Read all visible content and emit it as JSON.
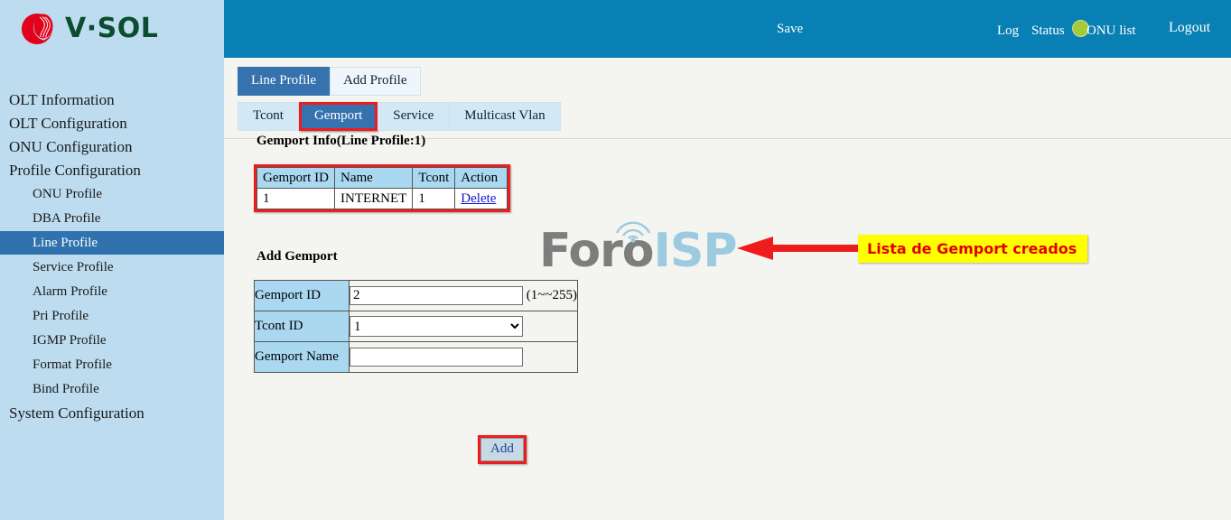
{
  "brand": {
    "name": "V·SOL",
    "logo_icon": "vsol-logo-icon",
    "logo_red": "#e2001a",
    "logo_green": "#0b4d2e"
  },
  "header": {
    "background": "#0880b4",
    "save_label": "Save",
    "status_dot_icon": "status-indicator-icon",
    "status_dot_color": "#a7ca3a",
    "links": [
      {
        "label": "Log"
      },
      {
        "label": "Status"
      },
      {
        "label": "ONU list"
      },
      {
        "label": "Logout"
      }
    ],
    "log_label": "Log",
    "status_label": "Status",
    "onu_list_label": "ONU list",
    "logout_label": "Logout"
  },
  "sidebar": {
    "background": "#bddcef",
    "active_background": "#2f72ad",
    "items": [
      {
        "label": "OLT Information",
        "level": 0,
        "active": false
      },
      {
        "label": "OLT Configuration",
        "level": 0,
        "active": false
      },
      {
        "label": "ONU Configuration",
        "level": 0,
        "active": false
      },
      {
        "label": "Profile Configuration",
        "level": 0,
        "active": false
      },
      {
        "label": "ONU Profile",
        "level": 1,
        "active": false
      },
      {
        "label": "DBA Profile",
        "level": 1,
        "active": false
      },
      {
        "label": "Line Profile",
        "level": 1,
        "active": true
      },
      {
        "label": "Service Profile",
        "level": 1,
        "active": false
      },
      {
        "label": "Alarm Profile",
        "level": 1,
        "active": false
      },
      {
        "label": "Pri Profile",
        "level": 1,
        "active": false
      },
      {
        "label": "IGMP Profile",
        "level": 1,
        "active": false
      },
      {
        "label": "Format Profile",
        "level": 1,
        "active": false
      },
      {
        "label": "Bind Profile",
        "level": 1,
        "active": false
      },
      {
        "label": "System Configuration",
        "level": 0,
        "active": false
      }
    ]
  },
  "main": {
    "primary_tabs": [
      {
        "label": "Line Profile",
        "active": true
      },
      {
        "label": "Add Profile",
        "active": false
      }
    ],
    "secondary_tabs": [
      {
        "label": "Tcont",
        "active": false
      },
      {
        "label": "Gemport",
        "active": true
      },
      {
        "label": "Service",
        "active": false
      },
      {
        "label": "Multicast Vlan",
        "active": false
      }
    ],
    "info_title": "Gemport Info(Line Profile:1)",
    "info_table": {
      "columns": [
        "Gemport ID",
        "Name",
        "Tcont",
        "Action"
      ],
      "rows": [
        {
          "gemport_id": "1",
          "name": "INTERNET",
          "tcont": "1",
          "action": "Delete"
        }
      ]
    },
    "add_title": "Add Gemport",
    "form": {
      "gemport_id_label": "Gemport ID",
      "gemport_id_value": "2",
      "gemport_id_hint": "(1~~255)",
      "tcont_id_label": "Tcont ID",
      "tcont_id_value": "1",
      "tcont_id_options": [
        "1"
      ],
      "gemport_name_label": "Gemport Name",
      "gemport_name_value": "",
      "gemport_name_placeholder": "",
      "add_button_label": "Add"
    }
  },
  "annotation": {
    "text": "Lista de Gemport creados",
    "background": "#ffff00",
    "text_color": "#e00000",
    "arrow_color": "#ee1c1c",
    "arrow_icon": "left-arrow-icon",
    "highlight_color": "#ee1c1c"
  },
  "watermark": {
    "text_primary": "Foro",
    "text_secondary": "ISP",
    "icon": "antenna-tower-icon",
    "color_primary": "#7d7d7d",
    "color_secondary": "#9ccbe0"
  }
}
